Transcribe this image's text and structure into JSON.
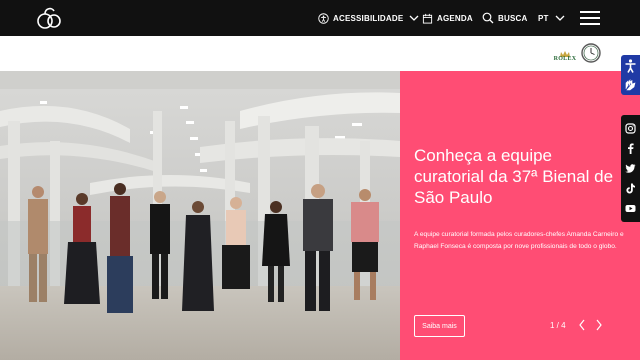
{
  "header": {
    "logo_name": "bienal-logo-icon",
    "accessibility_label": "ACESSIBILIDADE",
    "agenda_label": "AGENDA",
    "search_label": "BUSCA",
    "language_label": "PT"
  },
  "sponsor": {
    "name": "ROLEX"
  },
  "hero": {
    "title": "Conheça a equipe curatorial da 37ª Bienal de São Paulo",
    "description": "A equipe curatorial formada pelos curadores-chefes Amanda Carneiro e Raphael Fonseca é composta por nove profissionais de todo o globo.",
    "button_label": "Saiba mais",
    "pager": "1 / 4"
  },
  "side_tools": {
    "accessibility_icons": [
      "accessibility-person-icon",
      "sign-language-icon"
    ],
    "social_icons": [
      "instagram-icon",
      "facebook-icon",
      "twitter-icon",
      "tiktok-icon",
      "youtube-icon"
    ]
  },
  "colors": {
    "topbar": "#111111",
    "hero_panel": "#ff4d74",
    "accessibility_blue": "#1f3aa5",
    "rolex_green": "#2b6b3a"
  }
}
